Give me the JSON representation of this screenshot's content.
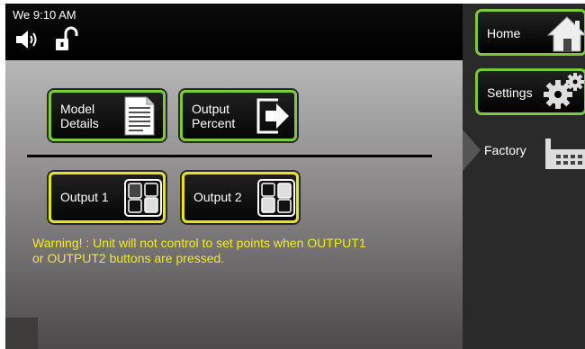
{
  "status_bar": {
    "time": "We 9:10 AM"
  },
  "main": {
    "buttons": {
      "model_details": "Model\nDetails",
      "output_percent": "Output\nPercent",
      "output_1": "Output 1",
      "output_2": "Output 2"
    },
    "warning": "Warning! : Unit will not control to set points when OUTPUT1 or OUTPUT2 buttons are pressed."
  },
  "nav": {
    "home": "Home",
    "settings": "Settings",
    "factory": "Factory"
  },
  "icons": [
    "speaker-icon",
    "unlocked-icon",
    "document-icon",
    "export-arrow-icon",
    "output-1-switch-icon",
    "output-2-switch-icon",
    "home-icon",
    "gears-icon",
    "factory-icon"
  ],
  "colors": {
    "active_border": "#7ec83c",
    "output_border": "#e6e321",
    "warning_text": "#f2ea26"
  }
}
